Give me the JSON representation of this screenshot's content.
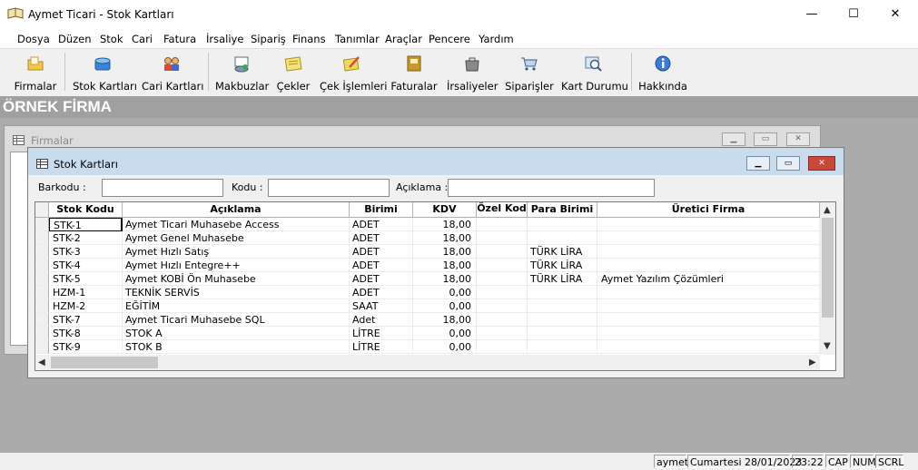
{
  "window": {
    "title": "Aymet Ticari - Stok Kartları",
    "minimize": "—",
    "maximize": "☐",
    "close": "✕"
  },
  "menu": [
    "Dosya",
    "Düzen",
    "Stok",
    "Cari",
    "Fatura",
    "İrsaliye",
    "Sipariş",
    "Finans",
    "Tanımlar",
    "Araçlar",
    "Pencere",
    "Yardım"
  ],
  "toolbar": [
    {
      "label": "Firmalar",
      "icon": "folder-icon",
      "color": "#f2c64a"
    },
    {
      "label": "Stok Kartları",
      "icon": "box-icon",
      "color": "#3a86d4"
    },
    {
      "label": "Cari Kartları",
      "icon": "people-icon",
      "color": "#d88a3a"
    },
    {
      "label": "Makbuzlar",
      "icon": "receipt-icon",
      "color": "#7a9ab8"
    },
    {
      "label": "Çekler",
      "icon": "note-icon",
      "color": "#f4e27a"
    },
    {
      "label": "Çek İşlemleri",
      "icon": "note-pencil-icon",
      "color": "#f0d860"
    },
    {
      "label": "Faturalar",
      "icon": "invoice-icon",
      "color": "#c89a2a"
    },
    {
      "label": "İrsaliyeler",
      "icon": "bag-icon",
      "color": "#8a8a8a"
    },
    {
      "label": "Siparişler",
      "icon": "cart-icon",
      "color": "#7aa8d8"
    },
    {
      "label": "Kart Durumu",
      "icon": "magnifier-icon",
      "color": "#5a8acc"
    },
    {
      "label": "Hakkında",
      "icon": "info-icon",
      "color": "#3a7ad8"
    }
  ],
  "firm_name": "ÖRNEK FİRMA",
  "firmalar_window": {
    "title": "Firmalar"
  },
  "stok_window": {
    "title": "Stok Kartları",
    "filters": {
      "barkod_label": "Barkodu :",
      "kod_label": "Kodu :",
      "aciklama_label": "Açıklama :",
      "barkod_value": "",
      "kod_value": "",
      "aciklama_value": ""
    },
    "columns": [
      "Stok Kodu",
      "Açıklama",
      "Birimi",
      "KDV",
      "Özel Kod",
      "Para Birimi",
      "Üretici Firma"
    ],
    "rows": [
      [
        "STK-1",
        "Aymet Ticari Muhasebe Access",
        "ADET",
        "18,00",
        "",
        "",
        ""
      ],
      [
        "STK-2",
        "Aymet Genel Muhasebe",
        "ADET",
        "18,00",
        "",
        "",
        ""
      ],
      [
        "STK-3",
        "Aymet Hızlı Satış",
        "ADET",
        "18,00",
        "",
        "TÜRK LİRA",
        ""
      ],
      [
        "STK-4",
        "Aymet Hızlı Entegre++",
        "ADET",
        "18,00",
        "",
        "TÜRK LİRA",
        ""
      ],
      [
        "STK-5",
        "Aymet KOBİ Ön Muhasebe",
        "ADET",
        "18,00",
        "",
        "TÜRK LİRA",
        "Aymet Yazılım Çözümleri"
      ],
      [
        "HZM-1",
        "TEKNİK SERVİS",
        "ADET",
        "0,00",
        "",
        "",
        ""
      ],
      [
        "HZM-2",
        "EĞİTİM",
        "SAAT",
        "0,00",
        "",
        "",
        ""
      ],
      [
        "STK-7",
        "Aymet Ticari Muhasebe SQL",
        "Adet",
        "18,00",
        "",
        "",
        ""
      ],
      [
        "STK-8",
        "STOK A",
        "LİTRE",
        "0,00",
        "",
        "",
        ""
      ],
      [
        "STK-9",
        "STOK B",
        "LİTRE",
        "0,00",
        "",
        "",
        ""
      ]
    ]
  },
  "status": {
    "user": "aymet",
    "date": "Cumartesi 28/01/2023",
    "time": "23:22",
    "cap": "CAP",
    "num": "NUM",
    "scrl": "SCRL"
  }
}
